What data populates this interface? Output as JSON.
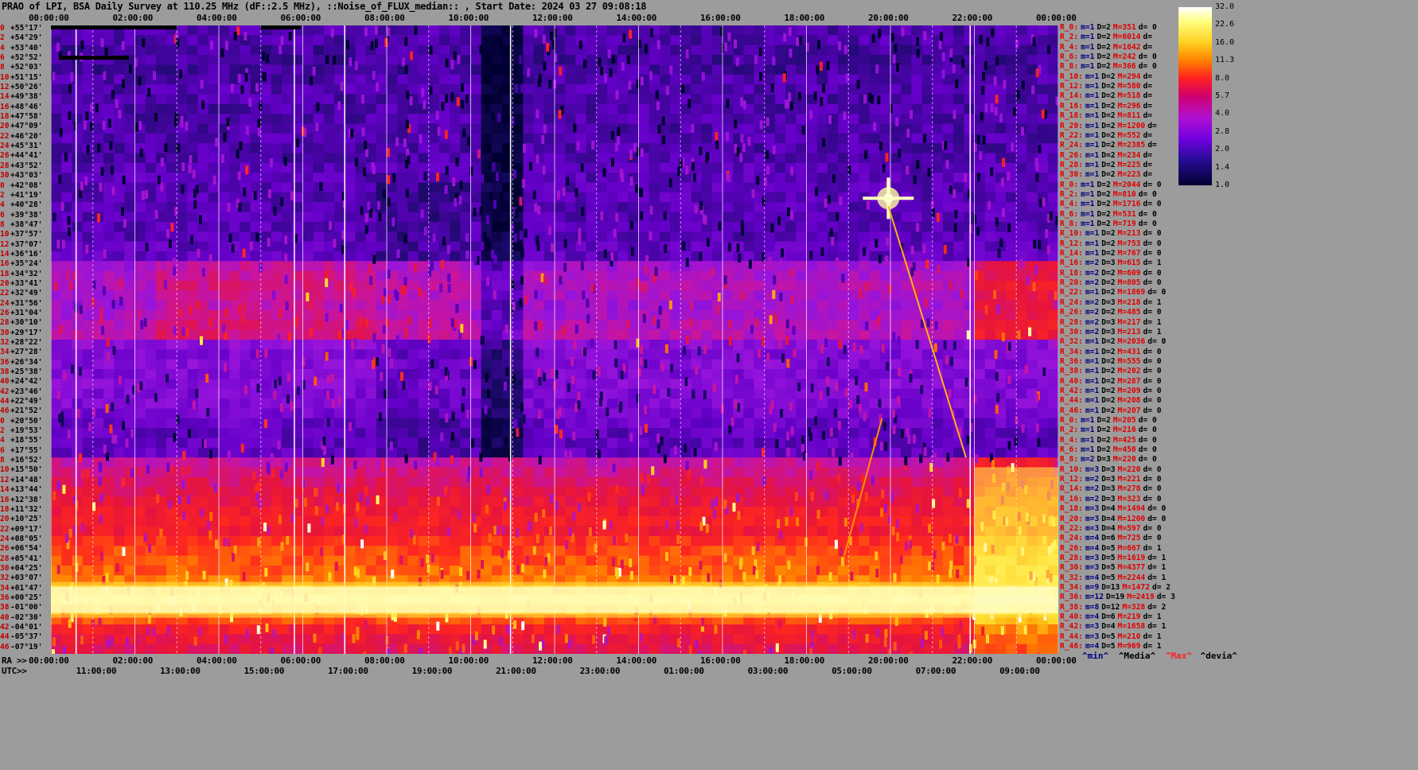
{
  "title": "PRAO of LPI, BSA Daily Survey at 110.25 MHz (dF::2.5 MHz), ::Noise_of_FLUX_median:: , Start Date: 2024 03 27 09:08:18",
  "top_time_labels": [
    "00:00:00",
    "02:00:00",
    "04:00:00",
    "06:00:00",
    "08:00:00",
    "10:00:00",
    "12:00:00",
    "14:00:00",
    "16:00:00",
    "18:00:00",
    "20:00:00",
    "22:00:00",
    "00:00:00"
  ],
  "ra_axis": {
    "prefix": "RA >>",
    "labels": [
      "00:00:00",
      "02:00:00",
      "04:00:00",
      "06:00:00",
      "08:00:00",
      "10:00:00",
      "12:00:00",
      "14:00:00",
      "16:00:00",
      "18:00:00",
      "20:00:00",
      "22:00:00",
      "00:00:00"
    ]
  },
  "utc_axis": {
    "prefix": "UTC>>",
    "labels": [
      "11:00:00",
      "13:00:00",
      "15:00:00",
      "17:00:00",
      "19:00:00",
      "21:00:00",
      "23:00:00",
      "01:00:00",
      "03:00:00",
      "05:00:00",
      "07:00:00",
      "09:00:00"
    ]
  },
  "declinations": [
    {
      "i": "0",
      "d": "+55°17'"
    },
    {
      "i": "2",
      "d": "+54°29'"
    },
    {
      "i": "4",
      "d": "+53°40'"
    },
    {
      "i": "6",
      "d": "+52°52'"
    },
    {
      "i": "8",
      "d": "+52°03'"
    },
    {
      "i": "10",
      "d": "+51°15'"
    },
    {
      "i": "12",
      "d": "+50°26'"
    },
    {
      "i": "14",
      "d": "+49°38'"
    },
    {
      "i": "16",
      "d": "+48°46'"
    },
    {
      "i": "18",
      "d": "+47°58'"
    },
    {
      "i": "20",
      "d": "+47°09'"
    },
    {
      "i": "22",
      "d": "+46°20'"
    },
    {
      "i": "24",
      "d": "+45°31'"
    },
    {
      "i": "26",
      "d": "+44°41'"
    },
    {
      "i": "28",
      "d": "+43°52'"
    },
    {
      "i": "30",
      "d": "+43°03'"
    },
    {
      "i": "0",
      "d": "+42°08'"
    },
    {
      "i": "2",
      "d": "+41°19'"
    },
    {
      "i": "4",
      "d": "+40°28'"
    },
    {
      "i": "6",
      "d": "+39°38'"
    },
    {
      "i": "8",
      "d": "+38°47'"
    },
    {
      "i": "10",
      "d": "+37°57'"
    },
    {
      "i": "12",
      "d": "+37°07'"
    },
    {
      "i": "14",
      "d": "+36°16'"
    },
    {
      "i": "16",
      "d": "+35°24'"
    },
    {
      "i": "18",
      "d": "+34°32'"
    },
    {
      "i": "20",
      "d": "+33°41'"
    },
    {
      "i": "22",
      "d": "+32°49'"
    },
    {
      "i": "24",
      "d": "+31°56'"
    },
    {
      "i": "26",
      "d": "+31°04'"
    },
    {
      "i": "28",
      "d": "+30°10'"
    },
    {
      "i": "30",
      "d": "+29°17'"
    },
    {
      "i": "32",
      "d": "+28°22'"
    },
    {
      "i": "34",
      "d": "+27°28'"
    },
    {
      "i": "36",
      "d": "+26°34'"
    },
    {
      "i": "38",
      "d": "+25°38'"
    },
    {
      "i": "40",
      "d": "+24°42'"
    },
    {
      "i": "42",
      "d": "+23°46'"
    },
    {
      "i": "44",
      "d": "+22°49'"
    },
    {
      "i": "46",
      "d": "+21°52'"
    },
    {
      "i": "0",
      "d": "+20°50'"
    },
    {
      "i": "2",
      "d": "+19°53'"
    },
    {
      "i": "4",
      "d": "+18°55'"
    },
    {
      "i": "6",
      "d": "+17°55'"
    },
    {
      "i": "8",
      "d": "+16°52'"
    },
    {
      "i": "10",
      "d": "+15°50'"
    },
    {
      "i": "12",
      "d": "+14°48'"
    },
    {
      "i": "14",
      "d": "+13°44'"
    },
    {
      "i": "16",
      "d": "+12°38'"
    },
    {
      "i": "18",
      "d": "+11°32'"
    },
    {
      "i": "20",
      "d": "+10°25'"
    },
    {
      "i": "22",
      "d": "+09°17'"
    },
    {
      "i": "24",
      "d": "+08°05'"
    },
    {
      "i": "26",
      "d": "+06°54'"
    },
    {
      "i": "28",
      "d": "+05°41'"
    },
    {
      "i": "30",
      "d": "+04°25'"
    },
    {
      "i": "32",
      "d": "+03°07'"
    },
    {
      "i": "34",
      "d": "+01°47'"
    },
    {
      "i": "36",
      "d": "+00°25'"
    },
    {
      "i": "38",
      "d": "-01°00'"
    },
    {
      "i": "40",
      "d": "-02°30'"
    },
    {
      "i": "42",
      "d": "-04°01'"
    },
    {
      "i": "44",
      "d": "-05°37'"
    },
    {
      "i": "46",
      "d": "-07°19'"
    }
  ],
  "row_stats": [
    {
      "r": "R_0:",
      "m": "m=1",
      "d": "D=2",
      "h": "M=351",
      "v": "d= 0"
    },
    {
      "r": "R_2:",
      "m": "m=1",
      "d": "D=2",
      "h": "M=6014",
      "v": "d="
    },
    {
      "r": "R_4:",
      "m": "m=1",
      "d": "D=2",
      "h": "M=1642",
      "v": "d="
    },
    {
      "r": "R_6:",
      "m": "m=1",
      "d": "D=2",
      "h": "M=242",
      "v": "d= 0"
    },
    {
      "r": "R_8:",
      "m": "m=1",
      "d": "D=2",
      "h": "M=366",
      "v": "d= 0"
    },
    {
      "r": "R_10:",
      "m": "m=1",
      "d": "D=2",
      "h": "M=294",
      "v": "d="
    },
    {
      "r": "R_12:",
      "m": "m=1",
      "d": "D=2",
      "h": "M=580",
      "v": "d="
    },
    {
      "r": "R_14:",
      "m": "m=1",
      "d": "D=2",
      "h": "M=518",
      "v": "d="
    },
    {
      "r": "R_16:",
      "m": "m=1",
      "d": "D=2",
      "h": "M=296",
      "v": "d="
    },
    {
      "r": "R_18:",
      "m": "m=1",
      "d": "D=2",
      "h": "M=811",
      "v": "d="
    },
    {
      "r": "R_20:",
      "m": "m=1",
      "d": "D=2",
      "h": "M=1200",
      "v": "d="
    },
    {
      "r": "R_22:",
      "m": "m=1",
      "d": "D=2",
      "h": "M=552",
      "v": "d="
    },
    {
      "r": "R_24:",
      "m": "m=1",
      "d": "D=2",
      "h": "M=2385",
      "v": "d="
    },
    {
      "r": "R_26:",
      "m": "m=1",
      "d": "D=2",
      "h": "M=234",
      "v": "d="
    },
    {
      "r": "R_28:",
      "m": "m=1",
      "d": "D=2",
      "h": "M=225",
      "v": "d="
    },
    {
      "r": "R_30:",
      "m": "m=1",
      "d": "D=2",
      "h": "M=223",
      "v": "d="
    },
    {
      "r": "R_0:",
      "m": "m=1",
      "d": "D=2",
      "h": "M=2044",
      "v": "d= 0"
    },
    {
      "r": "R_2:",
      "m": "m=1",
      "d": "D=2",
      "h": "M=810",
      "v": "d= 0"
    },
    {
      "r": "R_4:",
      "m": "m=1",
      "d": "D=2",
      "h": "M=1716",
      "v": "d= 0"
    },
    {
      "r": "R_6:",
      "m": "m=1",
      "d": "D=2",
      "h": "M=531",
      "v": "d= 0"
    },
    {
      "r": "R_8:",
      "m": "m=1",
      "d": "D=2",
      "h": "M=719",
      "v": "d= 0"
    },
    {
      "r": "R_10:",
      "m": "m=1",
      "d": "D=2",
      "h": "M=213",
      "v": "d= 0"
    },
    {
      "r": "R_12:",
      "m": "m=1",
      "d": "D=2",
      "h": "M=753",
      "v": "d= 0"
    },
    {
      "r": "R_14:",
      "m": "m=1",
      "d": "D=2",
      "h": "M=767",
      "v": "d= 0"
    },
    {
      "r": "R_16:",
      "m": "m=2",
      "d": "D=3",
      "h": "M=615",
      "v": "d= 1"
    },
    {
      "r": "R_18:",
      "m": "m=2",
      "d": "D=2",
      "h": "M=609",
      "v": "d= 0"
    },
    {
      "r": "R_20:",
      "m": "m=2",
      "d": "D=2",
      "h": "M=805",
      "v": "d= 0"
    },
    {
      "r": "R_22:",
      "m": "m=1",
      "d": "D=2",
      "h": "M=1869",
      "v": "d= 0"
    },
    {
      "r": "R_24:",
      "m": "m=2",
      "d": "D=3",
      "h": "M=218",
      "v": "d= 1"
    },
    {
      "r": "R_26:",
      "m": "m=2",
      "d": "D=2",
      "h": "M=485",
      "v": "d= 0"
    },
    {
      "r": "R_28:",
      "m": "m=2",
      "d": "D=3",
      "h": "M=217",
      "v": "d= 1"
    },
    {
      "r": "R_30:",
      "m": "m=2",
      "d": "D=3",
      "h": "M=213",
      "v": "d= 1"
    },
    {
      "r": "R_32:",
      "m": "m=1",
      "d": "D=2",
      "h": "M=2036",
      "v": "d= 0"
    },
    {
      "r": "R_34:",
      "m": "m=1",
      "d": "D=2",
      "h": "M=431",
      "v": "d= 0"
    },
    {
      "r": "R_36:",
      "m": "m=1",
      "d": "D=2",
      "h": "M=555",
      "v": "d= 0"
    },
    {
      "r": "R_38:",
      "m": "m=1",
      "d": "D=2",
      "h": "M=202",
      "v": "d= 0"
    },
    {
      "r": "R_40:",
      "m": "m=1",
      "d": "D=2",
      "h": "M=287",
      "v": "d= 0"
    },
    {
      "r": "R_42:",
      "m": "m=1",
      "d": "D=2",
      "h": "M=209",
      "v": "d= 0"
    },
    {
      "r": "R_44:",
      "m": "m=1",
      "d": "D=2",
      "h": "M=208",
      "v": "d= 0"
    },
    {
      "r": "R_46:",
      "m": "m=1",
      "d": "D=2",
      "h": "M=207",
      "v": "d= 0"
    },
    {
      "r": "R_0:",
      "m": "m=1",
      "d": "D=2",
      "h": "M=205",
      "v": "d= 0"
    },
    {
      "r": "R_2:",
      "m": "m=1",
      "d": "D=2",
      "h": "M=216",
      "v": "d= 0"
    },
    {
      "r": "R_4:",
      "m": "m=1",
      "d": "D=2",
      "h": "M=425",
      "v": "d= 0"
    },
    {
      "r": "R_6:",
      "m": "m=1",
      "d": "D=2",
      "h": "M=450",
      "v": "d= 0"
    },
    {
      "r": "R_8:",
      "m": "m=2",
      "d": "D=3",
      "h": "M=220",
      "v": "d= 0"
    },
    {
      "r": "R_10:",
      "m": "m=3",
      "d": "D=3",
      "h": "M=220",
      "v": "d= 0"
    },
    {
      "r": "R_12:",
      "m": "m=2",
      "d": "D=3",
      "h": "M=221",
      "v": "d= 0"
    },
    {
      "r": "R_14:",
      "m": "m=2",
      "d": "D=3",
      "h": "M=278",
      "v": "d= 0"
    },
    {
      "r": "R_16:",
      "m": "m=2",
      "d": "D=3",
      "h": "M=323",
      "v": "d= 0"
    },
    {
      "r": "R_18:",
      "m": "m=3",
      "d": "D=4",
      "h": "M=1494",
      "v": "d= 0"
    },
    {
      "r": "R_20:",
      "m": "m=3",
      "d": "D=4",
      "h": "M=1200",
      "v": "d= 0"
    },
    {
      "r": "R_22:",
      "m": "m=3",
      "d": "D=4",
      "h": "M=597",
      "v": "d= 0"
    },
    {
      "r": "R_24:",
      "m": "m=4",
      "d": "D=6",
      "h": "M=725",
      "v": "d= 0"
    },
    {
      "r": "R_26:",
      "m": "m=4",
      "d": "D=5",
      "h": "M=667",
      "v": "d= 1"
    },
    {
      "r": "R_28:",
      "m": "m=3",
      "d": "D=5",
      "h": "M=1619",
      "v": "d= 1"
    },
    {
      "r": "R_30:",
      "m": "m=3",
      "d": "D=5",
      "h": "M=4377",
      "v": "d= 1"
    },
    {
      "r": "R_32:",
      "m": "m=4",
      "d": "D=5",
      "h": "M=2244",
      "v": "d= 1"
    },
    {
      "r": "R_34:",
      "m": "m=9",
      "d": "D=13",
      "h": "M=1472",
      "v": "d= 2"
    },
    {
      "r": "R_36:",
      "m": "m=12",
      "d": "D=19",
      "h": "M=2419",
      "v": "d= 3"
    },
    {
      "r": "R_38:",
      "m": "m=8",
      "d": "D=12",
      "h": "M=328",
      "v": "d= 2"
    },
    {
      "r": "R_40:",
      "m": "m=4",
      "d": "D=6",
      "h": "M=219",
      "v": "d= 1"
    },
    {
      "r": "R_42:",
      "m": "m=3",
      "d": "D=4",
      "h": "M=1658",
      "v": "d= 1"
    },
    {
      "r": "R_44:",
      "m": "m=3",
      "d": "D=5",
      "h": "M=210",
      "v": "d= 1"
    },
    {
      "r": "R_46:",
      "m": "m=4",
      "d": "D=5",
      "h": "M=969",
      "v": "d= 1"
    }
  ],
  "colorbar": {
    "ticks": [
      "32.0",
      "22.6",
      "16.0",
      "11.3",
      "8.0",
      "5.7",
      "4.0",
      "2.8",
      "2.0",
      "1.4",
      "1.0"
    ],
    "colors": [
      "#ffffff",
      "#ffff70",
      "#ffd020",
      "#ff8000",
      "#ff2020",
      "#d00060",
      "#c010c0",
      "#8000e0",
      "#3010a0",
      "#000040"
    ]
  },
  "legend": {
    "min": "^min^",
    "median": "^Media^",
    "max": "^Max^",
    "devia": "^devia^"
  },
  "chart_data": {
    "type": "heatmap",
    "title": "PRAO of LPI, BSA Daily Survey at 110.25 MHz (dF::2.5 MHz), ::Noise_of_FLUX_median:: , Start Date: 2024 03 27 09:08:18",
    "x_axis": "RA 00:00:00 - 24:00:00 / UTC 09:08 - 09:00",
    "y_axis": "Declination +55°17' to -07°19'",
    "color_scale": [
      1.0,
      1.4,
      2.0,
      2.8,
      4.0,
      5.7,
      8.0,
      11.3,
      16.0,
      22.6,
      32.0
    ],
    "row_band_levels": [
      1.8,
      1.8,
      1.7,
      1.7,
      1.7,
      1.8,
      1.8,
      1.8,
      1.8,
      1.8,
      1.8,
      1.8,
      1.8,
      1.8,
      1.9,
      1.9,
      1.9,
      1.9,
      1.9,
      1.9,
      1.9,
      1.9,
      2.0,
      2.0,
      3.0,
      3.2,
      3.4,
      3.2,
      3.0,
      3.2,
      3.5,
      3.6,
      2.6,
      2.4,
      2.5,
      2.4,
      2.5,
      2.4,
      2.4,
      2.3,
      2.1,
      2.0,
      2.0,
      2.0,
      4.0,
      4.5,
      5.0,
      5.5,
      6.0,
      6.5,
      7.0,
      6.5,
      8.0,
      9.0,
      9.5,
      10.0,
      11.0,
      16.0,
      22.0,
      14.0,
      9.0,
      7.0,
      6.0,
      5.5
    ]
  }
}
